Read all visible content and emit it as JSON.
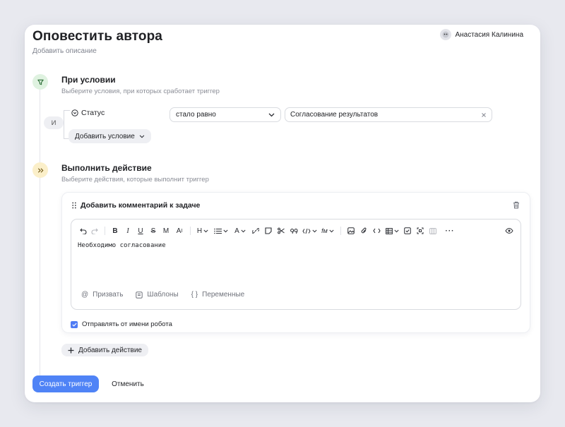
{
  "header": {
    "title": "Оповестить автора",
    "description_placeholder": "Добавить описание",
    "author_name": "Анастасия Калинина"
  },
  "condition_step": {
    "title": "При условии",
    "subtitle": "Выберите условия, при которых сработает триггер",
    "logic_label": "И",
    "condition": {
      "field": "Статус",
      "operator": "стало равно",
      "value": "Согласование результатов"
    },
    "add_condition_label": "Добавить условие"
  },
  "action_step": {
    "title": "Выполнить действие",
    "subtitle": "Выберите действия, которые выполнит триггер",
    "action": {
      "title": "Добавить комментарий к задаче",
      "editor_text": "Необходимо согласование",
      "footer": {
        "mention_label": "Призвать",
        "templates_label": "Шаблоны",
        "variables_label": "Переменные"
      },
      "send_as_robot_label": "Отправлять от имени робота",
      "send_as_robot_checked": true
    },
    "add_action_label": "Добавить действие"
  },
  "footer": {
    "create_label": "Создать триггер",
    "cancel_label": "Отменить"
  },
  "colors": {
    "accent": "#4f83f6",
    "condition_badge": "#dff2e0",
    "action_badge": "#fbefc9"
  }
}
